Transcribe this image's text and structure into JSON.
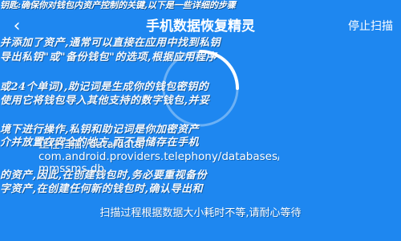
{
  "header": {
    "ticker": "钥匙:确保你对钱包内资产控制的关键,以下是一些详细的步骤",
    "title": "手机数据恢复精灵",
    "back_icon": "back-arrow-icon",
    "stop_label": "停止扫描"
  },
  "background_lines": [
    "并添加了资产,通常可以直接在应用中找到私钥",
    "导出私钥\"或\"备份钱包\"的选项,根据应用程序",
    "或24个单词),助记词是生成你的钱包密钥的",
    "使用它将钱包导入其他支持的数字钱包,并妥",
    "境下进行操作,私钥和助记词是你加密资产",
    "介并放置在安全的地方,而不是储存在手机",
    "的资产,因此,在创建钱包时,务必要重视备份",
    "字资产,在创建任何新的钱包时,确认导出和"
  ],
  "scan": {
    "status_line1": "正在扫描:/data/data/",
    "status_line2": "com.android.providers.telephony/databases/",
    "status_line3": "mmssms.db",
    "hint": "扫描过程根据数据大小耗时不等,请耐心等待"
  },
  "colors": {
    "background": "#1e87f0",
    "text": "#ffffff"
  }
}
